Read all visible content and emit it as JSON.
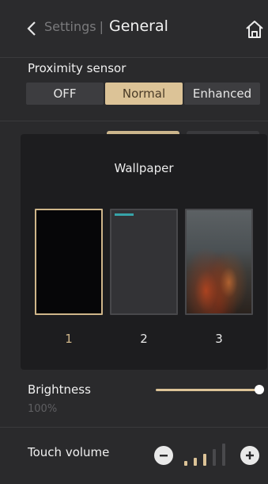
{
  "header": {
    "breadcrumb": "Settings",
    "separator": "|",
    "title": "General",
    "icons": {
      "back": "chevron-left-icon",
      "home": "home-icon"
    }
  },
  "proximity": {
    "label": "Proximity sensor",
    "options": [
      "OFF",
      "Normal",
      "Enhanced"
    ],
    "selected": "Normal"
  },
  "wallpaper_dialog": {
    "title": "Wallpaper",
    "options": [
      {
        "number": "1",
        "selected": true
      },
      {
        "number": "2",
        "selected": false
      },
      {
        "number": "3",
        "selected": false
      }
    ]
  },
  "brightness": {
    "label": "Brightness",
    "value": "100%",
    "level": 1.0
  },
  "touch_volume": {
    "label": "Touch volume",
    "level_bars": 3,
    "max_bars": 5
  },
  "colors": {
    "accent": "#dcc397",
    "background": "#2a2a2c",
    "dialog": "#1d1d1f"
  }
}
